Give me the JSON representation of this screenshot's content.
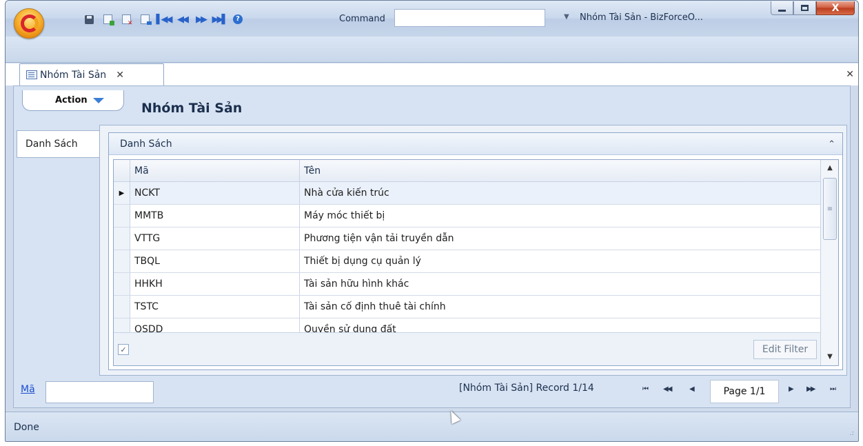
{
  "window": {
    "title": "Nhóm Tài Sản - BizForceO...",
    "close_glyph": "X"
  },
  "quick_access": {
    "command_label": "Command",
    "command_value": "",
    "help_glyph": "?",
    "more_glyph": "▼",
    "nav_first": "▌◀◀",
    "nav_prev": "◀◀",
    "nav_next": "▶▶",
    "nav_last": "▶▶▌"
  },
  "document_tab": {
    "label": "Nhóm Tài Sản",
    "close_glyph": "✕"
  },
  "strip_close_glyph": "✕",
  "action_menu": {
    "label": "Action"
  },
  "page_title": "Nhóm Tài Sản",
  "side_tab": {
    "label": "Danh Sách"
  },
  "group": {
    "title": "Danh Sách",
    "collapse_glyph": "⌃"
  },
  "grid": {
    "columns": {
      "code": "Mã",
      "name": "Tên"
    },
    "current_row_marker": "▶",
    "rows": [
      {
        "code": "NCKT",
        "name": "Nhà cửa kiến trúc"
      },
      {
        "code": "MMTB",
        "name": "Máy móc thiết bị"
      },
      {
        "code": "VTTG",
        "name": "Phương tiện vận tải truyền dẫn"
      },
      {
        "code": "TBQL",
        "name": "Thiết bị dụng cụ quản lý"
      },
      {
        "code": "HHKH",
        "name": "Tài sản hữu hình khác"
      },
      {
        "code": "TSTC",
        "name": "Tài sản cố định thuê tài chính"
      },
      {
        "code": "QSDD",
        "name": "Quyền sử dụng đất"
      }
    ],
    "filter_checked": true,
    "check_glyph": "✓",
    "edit_filter_label": "Edit Filter",
    "scroll_up_glyph": "▲",
    "scroll_down_glyph": "▼",
    "thumb_glyph": "≡"
  },
  "navigator": {
    "filter_label": "Mã",
    "filter_value": "",
    "record_text": "[Nhóm Tài Sản] Record 1/14",
    "first_glyph": "⏮",
    "prev_page_glyph": "◀◀",
    "prev_glyph": "◀",
    "page_text": "Page 1/1",
    "next_glyph": "▶",
    "next_page_glyph": "▶▶",
    "last_glyph": "⏭"
  },
  "status": {
    "text": "Done",
    "grip_glyph": ".:"
  }
}
